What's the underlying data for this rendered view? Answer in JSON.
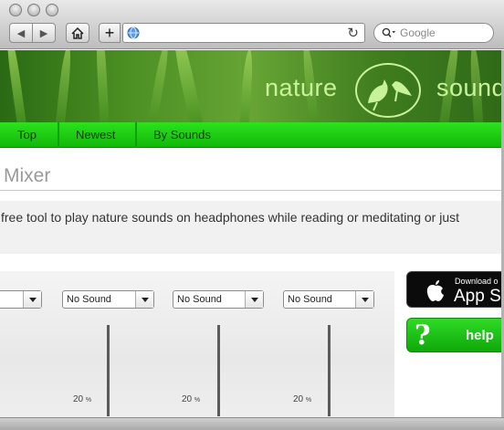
{
  "browser": {
    "back_glyph": "◀",
    "forward_glyph": "▶",
    "home_icon": "home-icon",
    "add_icon": "+",
    "url": "",
    "reload_glyph": "↻",
    "search_placeholder": "Google"
  },
  "banner": {
    "left_text": "nature",
    "right_text": "sound",
    "colors": {
      "text": "#c9f39b",
      "grass": "#4b8f23"
    }
  },
  "nav": {
    "items": [
      {
        "label": "Top"
      },
      {
        "label": "Newest"
      },
      {
        "label": "By Sounds"
      }
    ],
    "color": "#2ce21d"
  },
  "page": {
    "title": "Mixer",
    "intro": "free tool to play nature sounds on headphones while reading or meditating or just"
  },
  "mixer": {
    "channels": [
      {
        "select": "",
        "volume": "",
        "unit": ""
      },
      {
        "select": "No Sound",
        "volume": "20",
        "unit": "%"
      },
      {
        "select": "No Sound",
        "volume": "20",
        "unit": "%"
      },
      {
        "select": "No Sound",
        "volume": "20",
        "unit": "%"
      }
    ]
  },
  "sidebar": {
    "appstore_small": "Download o",
    "appstore_big": "App St",
    "help_q": "?",
    "help_label": "help"
  }
}
